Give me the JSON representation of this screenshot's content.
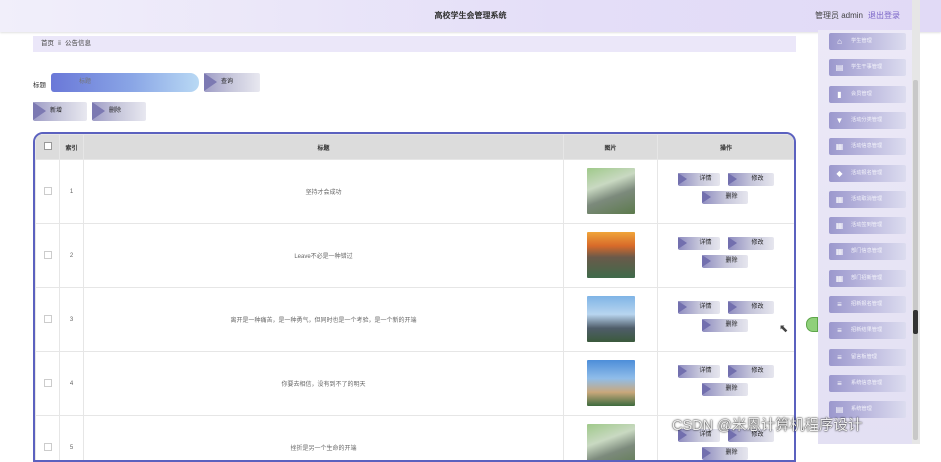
{
  "header": {
    "title": "高校学生会管理系统",
    "admin": "管理员 admin",
    "logout": "退出登录"
  },
  "breadcrumb": {
    "home": "首页",
    "sep": "ⅱ",
    "current": "公告信息"
  },
  "search": {
    "label": "标题",
    "placeholder": "标题",
    "button": "查询"
  },
  "actions": {
    "add": "新增",
    "delete": "删除"
  },
  "table": {
    "columns": [
      "索引",
      "标题",
      "图片",
      "操作"
    ],
    "rows": [
      {
        "index": "1",
        "title": "坚持才会成功"
      },
      {
        "index": "2",
        "title": "Leave不必是一种错过"
      },
      {
        "index": "3",
        "title": "离开是一种痛苦，是一种勇气，但同时也是一个考验，是一个新的开端"
      },
      {
        "index": "4",
        "title": "你要去相信，没有到不了的明天"
      },
      {
        "index": "5",
        "title": "挫折是另一个生命的开端"
      }
    ],
    "row_actions": {
      "detail": "详情",
      "edit": "修改",
      "delete": "删除"
    }
  },
  "sidebar": {
    "items": [
      {
        "label": "学生管理",
        "icon": "home-icon"
      },
      {
        "label": "学生干事管理",
        "icon": "doc-icon"
      },
      {
        "label": "会员管理",
        "icon": "chart-icon"
      },
      {
        "label": "活动分类管理",
        "icon": "funnel-icon"
      },
      {
        "label": "活动信息管理",
        "icon": "grid-icon"
      },
      {
        "label": "活动报名管理",
        "icon": "tag-icon"
      },
      {
        "label": "活动取消管理",
        "icon": "grid-icon"
      },
      {
        "label": "活动签到管理",
        "icon": "grid-icon"
      },
      {
        "label": "部门信息管理",
        "icon": "grid-icon"
      },
      {
        "label": "部门招新管理",
        "icon": "grid-icon"
      },
      {
        "label": "招新报名管理",
        "icon": "list-icon"
      },
      {
        "label": "招新结果管理",
        "icon": "list-icon"
      },
      {
        "label": "留言板管理",
        "icon": "list-icon"
      },
      {
        "label": "系统信息管理",
        "icon": "list-icon"
      },
      {
        "label": "系统管理",
        "icon": "doc-icon"
      }
    ]
  },
  "watermark": "CSDN @米恩计算机程序设计"
}
